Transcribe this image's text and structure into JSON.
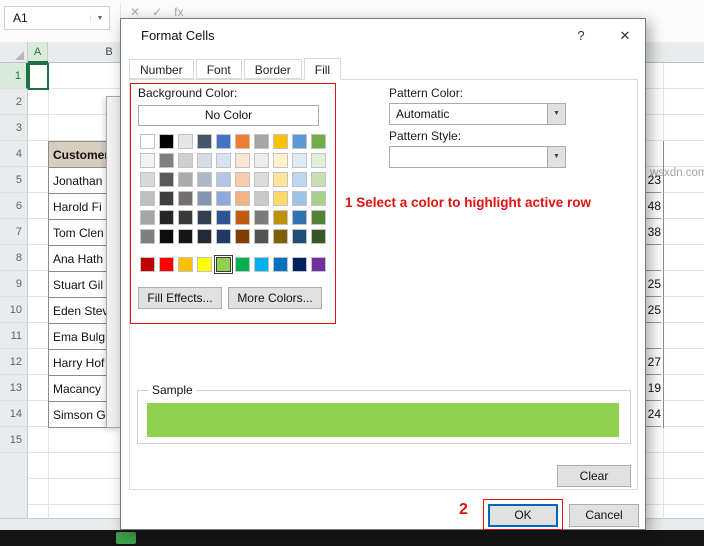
{
  "icons": {
    "dropdown": "▼"
  },
  "excel": {
    "name_box_value": "A1",
    "formula_bar_icons": {
      "cancel": "✕",
      "enter": "✓",
      "fx": "fx"
    },
    "column_headers": [
      "A",
      "B"
    ],
    "row_numbers": [
      "1",
      "2",
      "3",
      "4",
      "5",
      "6",
      "7",
      "8",
      "9",
      "10",
      "11",
      "12",
      "13",
      "14",
      "15"
    ],
    "table": {
      "header": "Customer",
      "names": [
        "Jonathan",
        "Harold Fi",
        "Tom Clen",
        "Ana Hath",
        "Stuart Gil",
        "Eden Stev",
        "Ema Bulg",
        "Harry Hof",
        "Macancy",
        "Simson G"
      ],
      "values": [
        "23",
        "48",
        "38",
        "",
        "25",
        "25",
        "",
        "27",
        "19",
        "24"
      ]
    },
    "watermark": "wsxdn.com"
  },
  "dialog": {
    "title": "Format Cells",
    "help_glyph": "?",
    "close_glyph": "✕",
    "tabs": [
      {
        "label": "Number",
        "active": false
      },
      {
        "label": "Font",
        "active": false
      },
      {
        "label": "Border",
        "active": false
      },
      {
        "label": "Fill",
        "active": true
      }
    ],
    "fill": {
      "background_color_label": "Background Color:",
      "no_color_button": "No Color",
      "palette_theme": [
        [
          "#FFFFFF",
          "#000000",
          "#E7E6E6",
          "#44546A",
          "#4472C4",
          "#ED7D31",
          "#A5A5A5",
          "#FFC000",
          "#5B9BD5",
          "#70AD47"
        ],
        [
          "#F2F2F2",
          "#7F7F7F",
          "#D0CECE",
          "#D6DCE4",
          "#D9E2F3",
          "#FBE5D5",
          "#EDEDED",
          "#FFF2CC",
          "#DEEBF6",
          "#E2EFD9"
        ],
        [
          "#D8D8D8",
          "#595959",
          "#AEABAB",
          "#ACB9CA",
          "#B4C6E7",
          "#F7CBAC",
          "#DBDBDB",
          "#FFE599",
          "#BDD7EE",
          "#C5E0B3"
        ],
        [
          "#BFBFBF",
          "#3F3F3F",
          "#757070",
          "#8496B0",
          "#8EAADB",
          "#F4B183",
          "#C9C9C9",
          "#FFD966",
          "#9DC3E6",
          "#A8D08D"
        ],
        [
          "#A5A5A5",
          "#262626",
          "#3A3838",
          "#333F50",
          "#2F5496",
          "#C45911",
          "#7B7B7B",
          "#BF9000",
          "#2E74B5",
          "#538135"
        ],
        [
          "#7F7F7F",
          "#0C0C0C",
          "#171616",
          "#222A35",
          "#1F3864",
          "#833C00",
          "#525252",
          "#7F6000",
          "#1F4E79",
          "#375623"
        ]
      ],
      "palette_standard": [
        "#C00000",
        "#FF0000",
        "#FFC000",
        "#FFFF00",
        "#92D050",
        "#00B050",
        "#00B0F0",
        "#0070C0",
        "#002060",
        "#7030A0"
      ],
      "selected_color": "#92D050",
      "fill_effects_button": "Fill Effects...",
      "more_colors_button": "More Colors...",
      "pattern_color_label": "Pattern Color:",
      "pattern_color_value": "Automatic",
      "pattern_style_label": "Pattern Style:",
      "sample_label": "Sample",
      "sample_color": "#92D050",
      "clear_button": "Clear"
    },
    "ok_button": "OK",
    "cancel_button": "Cancel"
  },
  "annotations": {
    "step1_text": "1 Select a color to highlight active row",
    "step2_text": "2",
    "color": "#E01212"
  }
}
